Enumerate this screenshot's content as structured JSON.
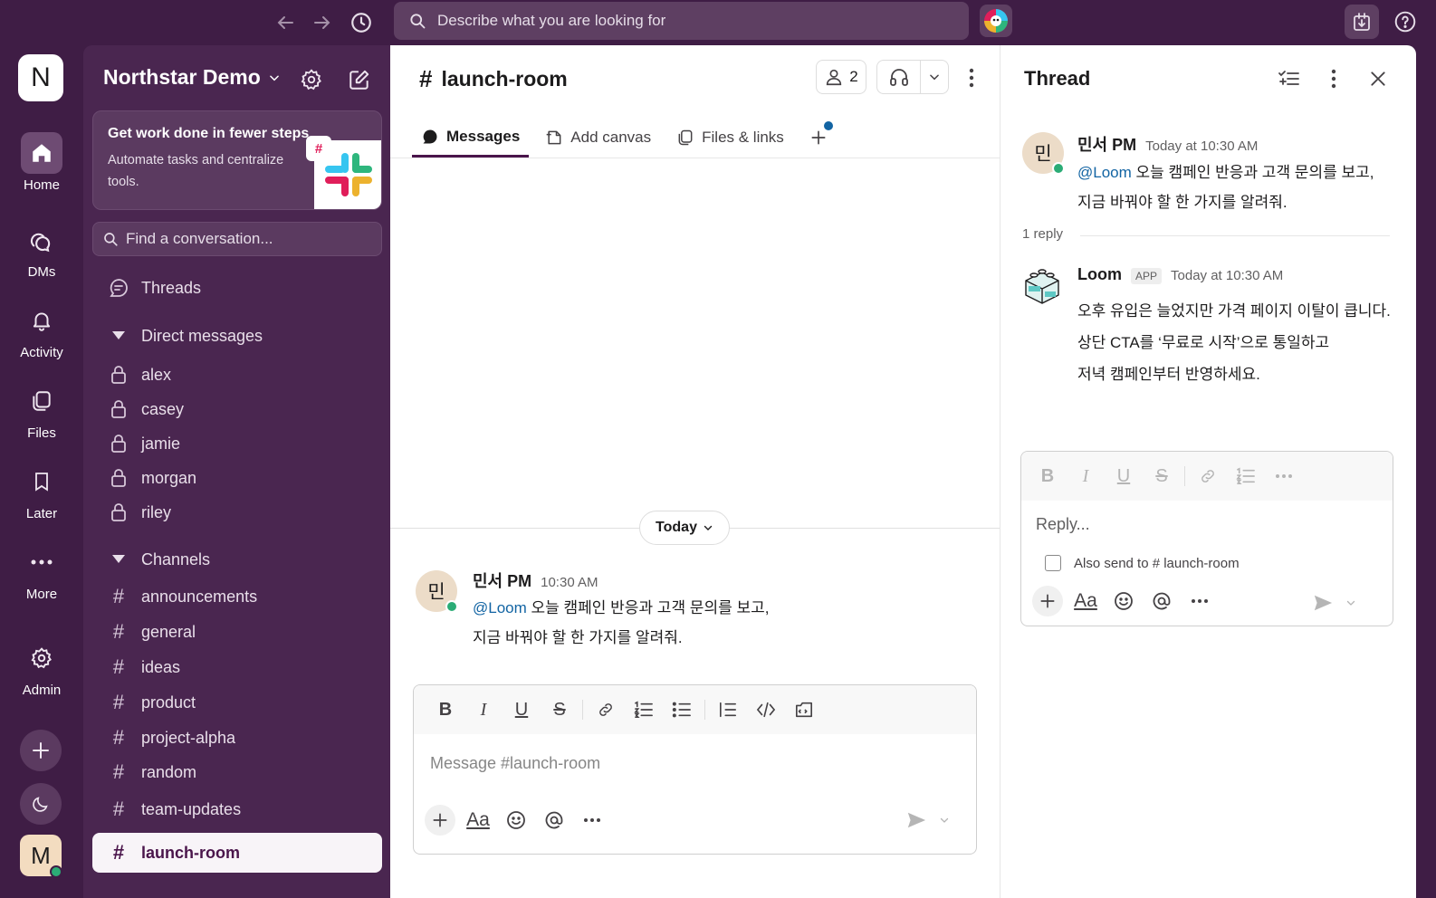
{
  "topbar": {
    "search_placeholder": "Describe what you are looking for"
  },
  "rail": {
    "workspace_initial": "N",
    "items": [
      {
        "label": "Home",
        "icon": "home-icon"
      },
      {
        "label": "DMs",
        "icon": "dms-icon"
      },
      {
        "label": "Activity",
        "icon": "bell-icon"
      },
      {
        "label": "Files",
        "icon": "files-icon"
      },
      {
        "label": "Later",
        "icon": "bookmark-icon"
      },
      {
        "label": "More",
        "icon": "more-icon"
      },
      {
        "label": "Admin",
        "icon": "gear-icon"
      }
    ],
    "user_initial": "M"
  },
  "sidebar": {
    "workspace_name": "Northstar Demo",
    "promo": {
      "title": "Get work done in fewer steps",
      "body": "Automate tasks and centralize tools."
    },
    "find_placeholder": "Find a conversation...",
    "threads_label": "Threads",
    "dm_section": "Direct messages",
    "dms": [
      "alex",
      "casey",
      "jamie",
      "morgan",
      "riley"
    ],
    "channels_section": "Channels",
    "channels": [
      "announcements",
      "general",
      "ideas",
      "product",
      "project-alpha",
      "random",
      "team-updates",
      "launch-room"
    ],
    "active_channel": "launch-room"
  },
  "main": {
    "channel_name": "launch-room",
    "member_count": "2",
    "tabs": [
      {
        "label": "Messages",
        "active": true
      },
      {
        "label": "Add canvas",
        "active": false
      },
      {
        "label": "Files & links",
        "active": false
      }
    ],
    "day_label": "Today",
    "message": {
      "avatar": "민",
      "author": "민서 PM",
      "time": "10:30 AM",
      "mention": "@Loom",
      "line1": " 오늘 캠페인 반응과 고객 문의를 보고,",
      "line2": "지금 바꿔야 할 한 가지를 알려줘."
    },
    "composer_placeholder": "Message #launch-room"
  },
  "thread": {
    "title": "Thread",
    "parent": {
      "avatar": "민",
      "author": "민서 PM",
      "time": "Today at 10:30 AM",
      "mention": "@Loom",
      "line1": " 오늘 캠페인 반응과 고객 문의를 보고,",
      "line2": "지금 바꿔야 할 한 가지를 알려줘."
    },
    "reply_count": "1 reply",
    "reply": {
      "author": "Loom",
      "badge": "APP",
      "time": "Today at 10:30 AM",
      "lines": [
        "오후 유입은 늘었지만 가격 페이지 이탈이 큽니다.",
        "상단 CTA를 ‘무료로 시작’으로 통일하고",
        "저녁 캠페인부터 반영하세요."
      ]
    },
    "reply_placeholder": "Reply...",
    "also_send_label": "Also send to # launch-room"
  },
  "colors": {
    "aubergine": "#3f1d45",
    "sidebar": "#4a2650",
    "mention": "#1264a3",
    "presence": "#2bac76"
  }
}
